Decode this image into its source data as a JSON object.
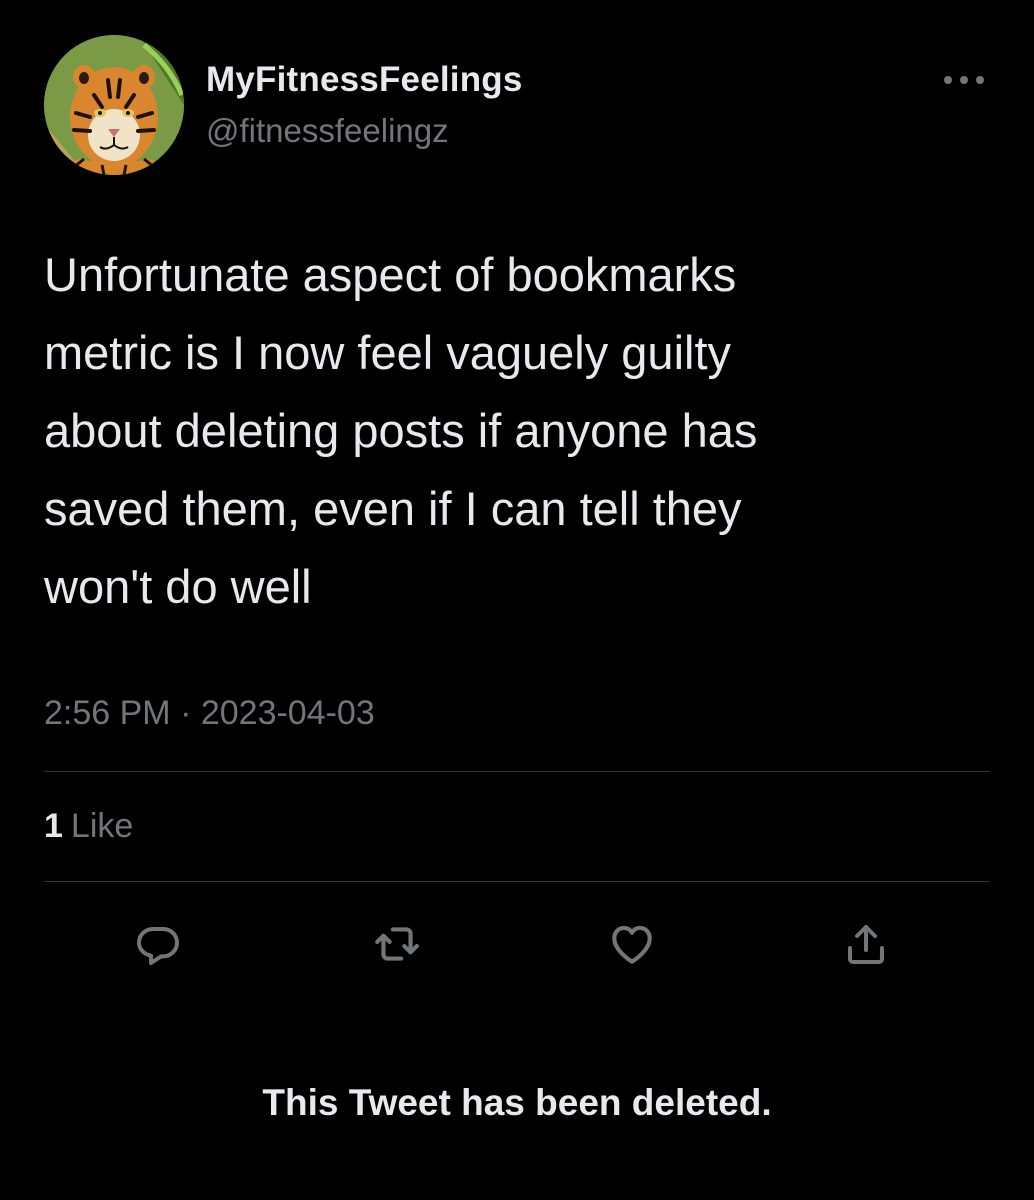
{
  "author": {
    "display_name": "MyFitnessFeelings",
    "handle": "@fitnessfeelingz",
    "avatar_icon": "tiger-avatar"
  },
  "tweet": {
    "text": "Unfortunate aspect of bookmarks\nmetric is I now feel vaguely guilty\nabout deleting posts if anyone has\nsaved them, even if I can tell they\nwon't do well",
    "timestamp": "2:56 PM · 2023-04-03"
  },
  "stats": {
    "likes_count": "1",
    "likes_label": "Like"
  },
  "actions": {
    "reply_icon": "reply-icon",
    "retweet_icon": "retweet-icon",
    "like_icon": "heart-icon",
    "share_icon": "share-icon",
    "more_icon": "more-icon"
  },
  "notice": {
    "deleted_text": "This Tweet has been deleted."
  },
  "colors": {
    "background": "#000000",
    "primary_text": "#e7e9ea",
    "secondary_text": "#71767b",
    "divider": "#2f3336"
  }
}
